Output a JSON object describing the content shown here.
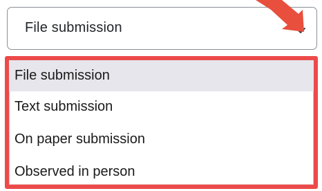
{
  "select": {
    "value": "File submission",
    "chevron_icon": "chevron-down-icon"
  },
  "dropdown": {
    "options": [
      {
        "label": "File submission",
        "selected": true
      },
      {
        "label": "Text submission",
        "selected": false
      },
      {
        "label": "On paper submission",
        "selected": false
      },
      {
        "label": "Observed in person",
        "selected": false
      }
    ]
  },
  "annotation": {
    "arrow_icon": "annotation-arrow-icon",
    "highlight_color": "#ec4a4a"
  },
  "colors": {
    "selected_background": "#e6e6ec",
    "border": "#8a8f96"
  }
}
